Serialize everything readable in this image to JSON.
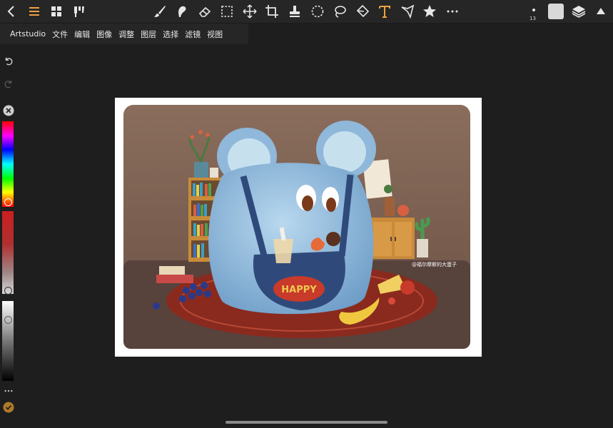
{
  "app": {
    "name": "Artstudio"
  },
  "menu": [
    "文件",
    "编辑",
    "图像",
    "调整",
    "图层",
    "选择",
    "滤镜",
    "视图"
  ],
  "brush": {
    "size_label": "13"
  },
  "colors": {
    "accent": "#f0a040",
    "current_color": "#d9d9d9"
  },
  "sliders": {
    "hue_level": 0.85,
    "saturation_level": 0.8,
    "lightness_level": 0.25
  },
  "artwork": {
    "belly_text": "HAPPY",
    "watermark": "@福尔摩斯的大蛋子"
  }
}
